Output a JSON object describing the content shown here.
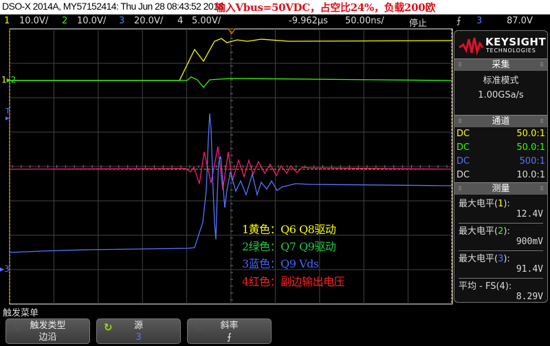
{
  "header": {
    "title": "DSO-X 2014A, MY57152414: Thu Jun 28 08:43:52 2018",
    "annotation": "输入Vbus=50VDC，占空比24%，负载200欧"
  },
  "channels": [
    {
      "num": "1",
      "scale": "10.0V/",
      "color": "#ffff00"
    },
    {
      "num": "2",
      "scale": "10.0V/",
      "color": "#33ff00"
    },
    {
      "num": "3",
      "scale": "20.0V/",
      "color": "#5577ff"
    },
    {
      "num": "4",
      "scale": "5.00V/",
      "color": "#ff1a7a"
    }
  ],
  "timebase": {
    "delay": "-9.962µs",
    "scale": "50.00ns/",
    "run_state": "停止",
    "trigger_slope_icon": "rising-edge-icon",
    "trigger_source": "3",
    "trigger_level": "87.0V"
  },
  "legend": [
    {
      "text": "1黄色：Q6 Q8驱动",
      "color": "#ffff00"
    },
    {
      "text": "2绿色：Q7 Q9驱动",
      "color": "#22cc44"
    },
    {
      "text": "3蓝色：Q9 Vds",
      "color": "#4466ff"
    },
    {
      "text": "4红色：副边输出电压",
      "color": "#ff2222"
    }
  ],
  "markers": {
    "ch1": "1",
    "ch2": "2",
    "ch3": "3",
    "ch4": "4",
    "trigger": "T"
  },
  "side": {
    "brand": "KEYSIGHT",
    "brand_sub": "TECHNOLOGIES",
    "acq_header": "采集",
    "acq_mode": "标准模式",
    "acq_rate": "1.00GSa/s",
    "ch_header": "通道",
    "probes": [
      {
        "coupling": "DC",
        "ratio": "50.0:1"
      },
      {
        "coupling": "DC",
        "ratio": "50.0:1"
      },
      {
        "coupling": "DC",
        "ratio": "500:1"
      },
      {
        "coupling": "DC",
        "ratio": "10.0:1"
      }
    ],
    "meas_header": "测量",
    "measurements": [
      {
        "label": "最大电平(",
        "ch": "1",
        "end": "):",
        "value": "12.4V"
      },
      {
        "label": "最大电平(",
        "ch": "2",
        "end": "):",
        "value": "900mV"
      },
      {
        "label": "最大电平(",
        "ch": "3",
        "end": "):",
        "value": "91.4V"
      },
      {
        "label": "平均 - FS(",
        "ch": "4",
        "end": "):",
        "value": "8.29V"
      }
    ]
  },
  "softkeys": {
    "menu_title": "触发菜单",
    "buttons": [
      {
        "label": "触发类型",
        "value": "边沿"
      },
      {
        "label": "源",
        "value": "3"
      },
      {
        "label": "斜率",
        "value": "⨍"
      }
    ]
  }
}
